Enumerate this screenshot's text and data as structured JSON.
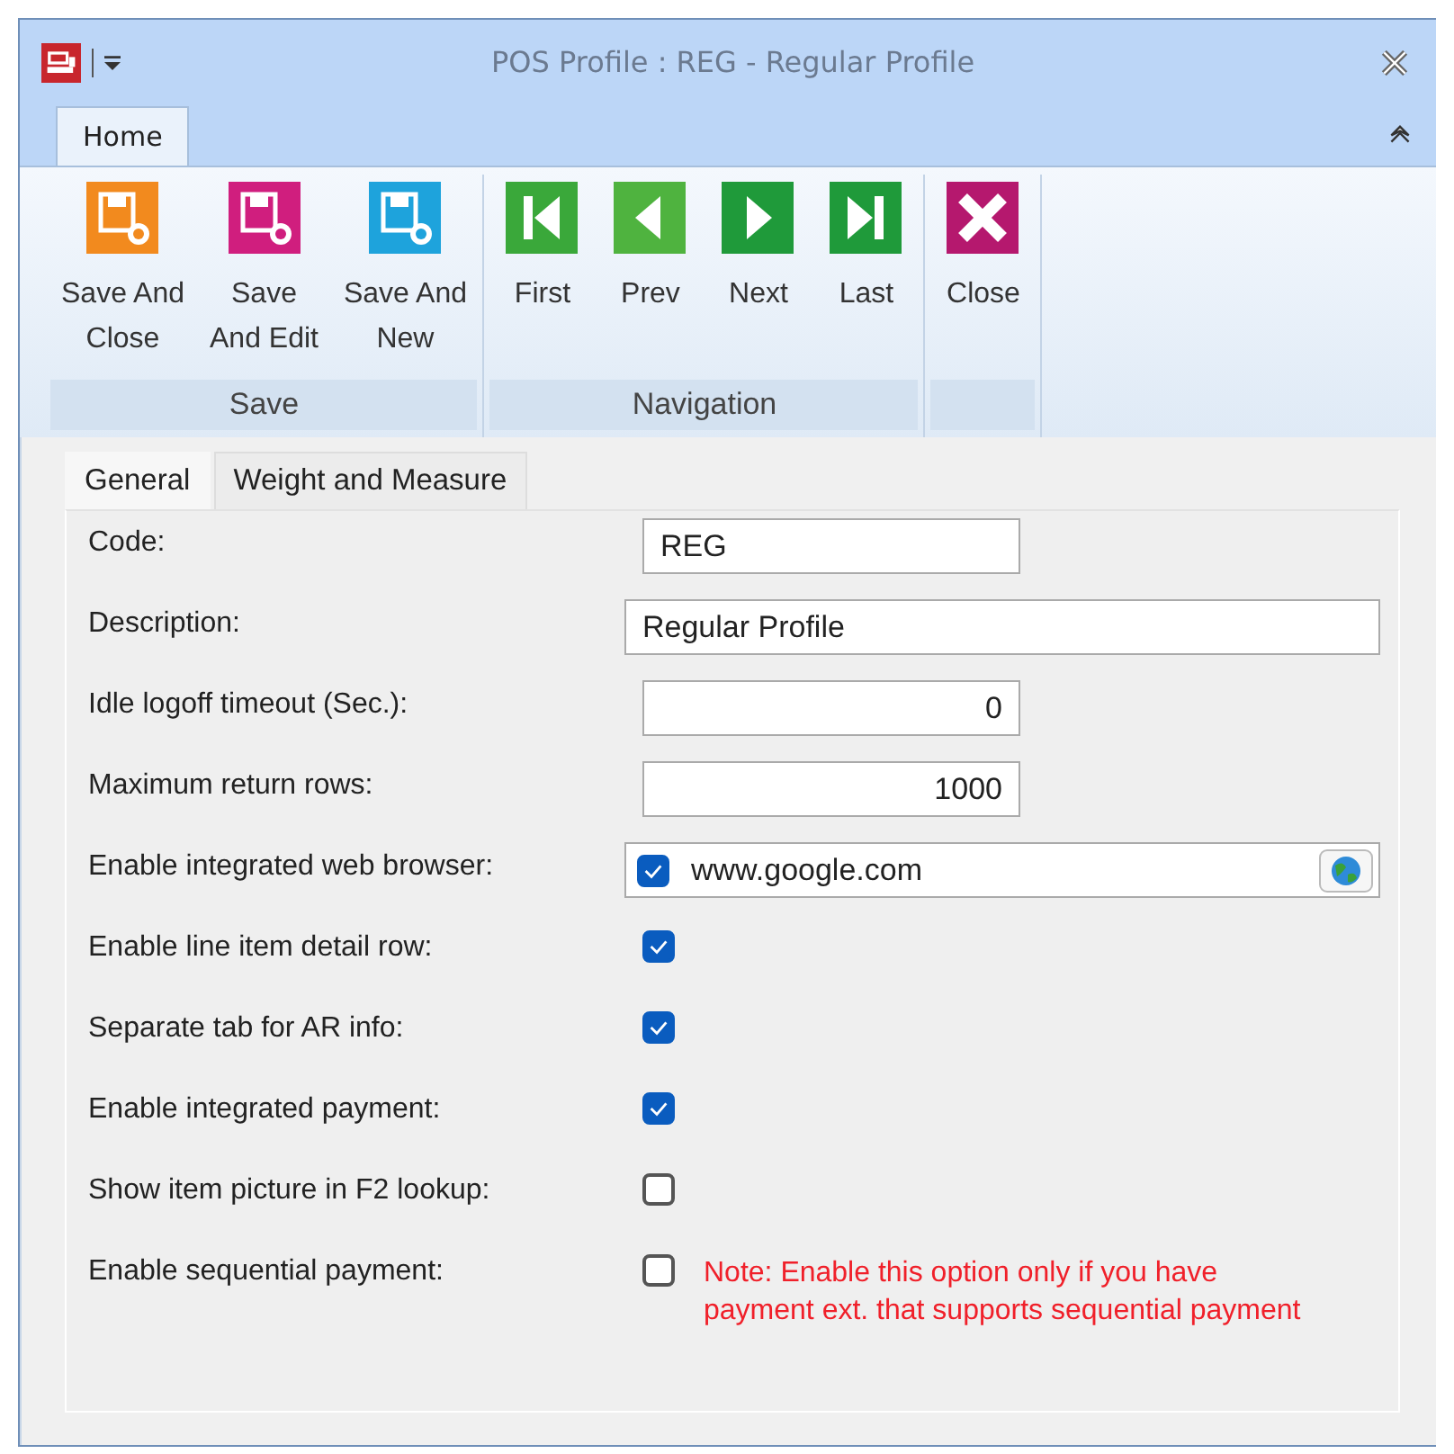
{
  "window": {
    "title": "POS Profile : REG - Regular Profile"
  },
  "ribbon": {
    "tabs": [
      {
        "label": "Home",
        "selected": true
      }
    ],
    "groups": [
      {
        "label": "Save",
        "buttons": [
          {
            "label": "Save And\nClose",
            "kind": "save-close"
          },
          {
            "label": "Save\nAnd Edit",
            "kind": "save-edit"
          },
          {
            "label": "Save And\nNew",
            "kind": "save-new"
          }
        ]
      },
      {
        "label": "Navigation",
        "buttons": [
          {
            "label": "First",
            "kind": "first"
          },
          {
            "label": "Prev",
            "kind": "prev"
          },
          {
            "label": "Next",
            "kind": "next"
          },
          {
            "label": "Last",
            "kind": "last"
          }
        ]
      },
      {
        "buttons": [
          {
            "label": "Close",
            "kind": "close"
          }
        ]
      }
    ]
  },
  "form_tabs": [
    {
      "label": "General",
      "selected": true
    },
    {
      "label": "Weight and Measure",
      "selected": false
    }
  ],
  "fields": [
    {
      "label": "Code:",
      "kind": "text",
      "value": "REG"
    },
    {
      "label": "Description:",
      "kind": "wide",
      "value": "Regular Profile"
    },
    {
      "label": "Idle logoff timeout (Sec.):",
      "kind": "number",
      "value": "0"
    },
    {
      "label": "Maximum return rows:",
      "kind": "number",
      "value": "1000"
    },
    {
      "label": "Enable integrated web browser:",
      "kind": "url",
      "checked": true,
      "value": "www.google.com"
    },
    {
      "label": "Enable line item detail row:",
      "kind": "checkbox",
      "checked": true
    },
    {
      "label": "Separate tab for AR info:",
      "kind": "checkbox",
      "checked": true
    },
    {
      "label": "Enable integrated payment:",
      "kind": "checkbox",
      "checked": true
    },
    {
      "label": "Show item picture in F2 lookup:",
      "kind": "checkbox",
      "checked": false
    },
    {
      "label": "Enable sequential payment:",
      "kind": "checkbox",
      "checked": false,
      "note": "Note: Enable this option only if you have\npayment ext. that supports sequential payment"
    }
  ]
}
